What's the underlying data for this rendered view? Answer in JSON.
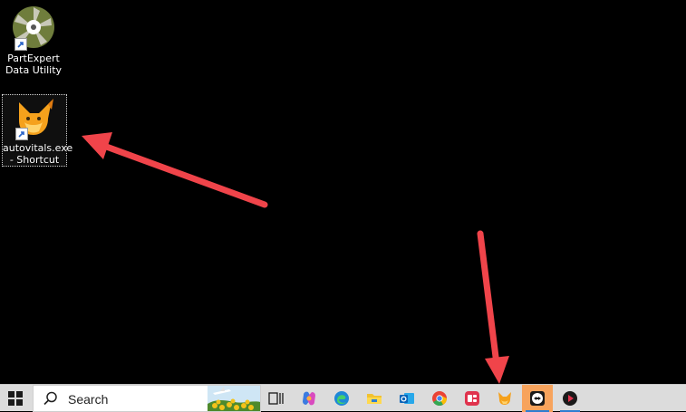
{
  "desktop": {
    "icons": [
      {
        "label_line1": "PartExpert",
        "label_line2": "Data Utility"
      },
      {
        "label_line1": "autovitals.exe",
        "label_line2": "- Shortcut"
      }
    ]
  },
  "taskbar": {
    "search_label": "Search",
    "pinned": [
      "start-windows-icon",
      "task-view-icon",
      "copilot-icon",
      "edge-browser-icon",
      "file-explorer-icon",
      "outlook-icon",
      "chrome-browser-icon",
      "red-app-icon",
      "autovitals-fox-icon",
      "teamviewer-icon",
      "media-player-icon"
    ]
  },
  "annotations": {
    "arrow_color": "#f0444a"
  },
  "colors": {
    "desktop_bg": "#000000",
    "taskbar_bg": "#dcdcdc",
    "highlight": "#f7a35c",
    "active_underline": "#2d7dd2"
  }
}
